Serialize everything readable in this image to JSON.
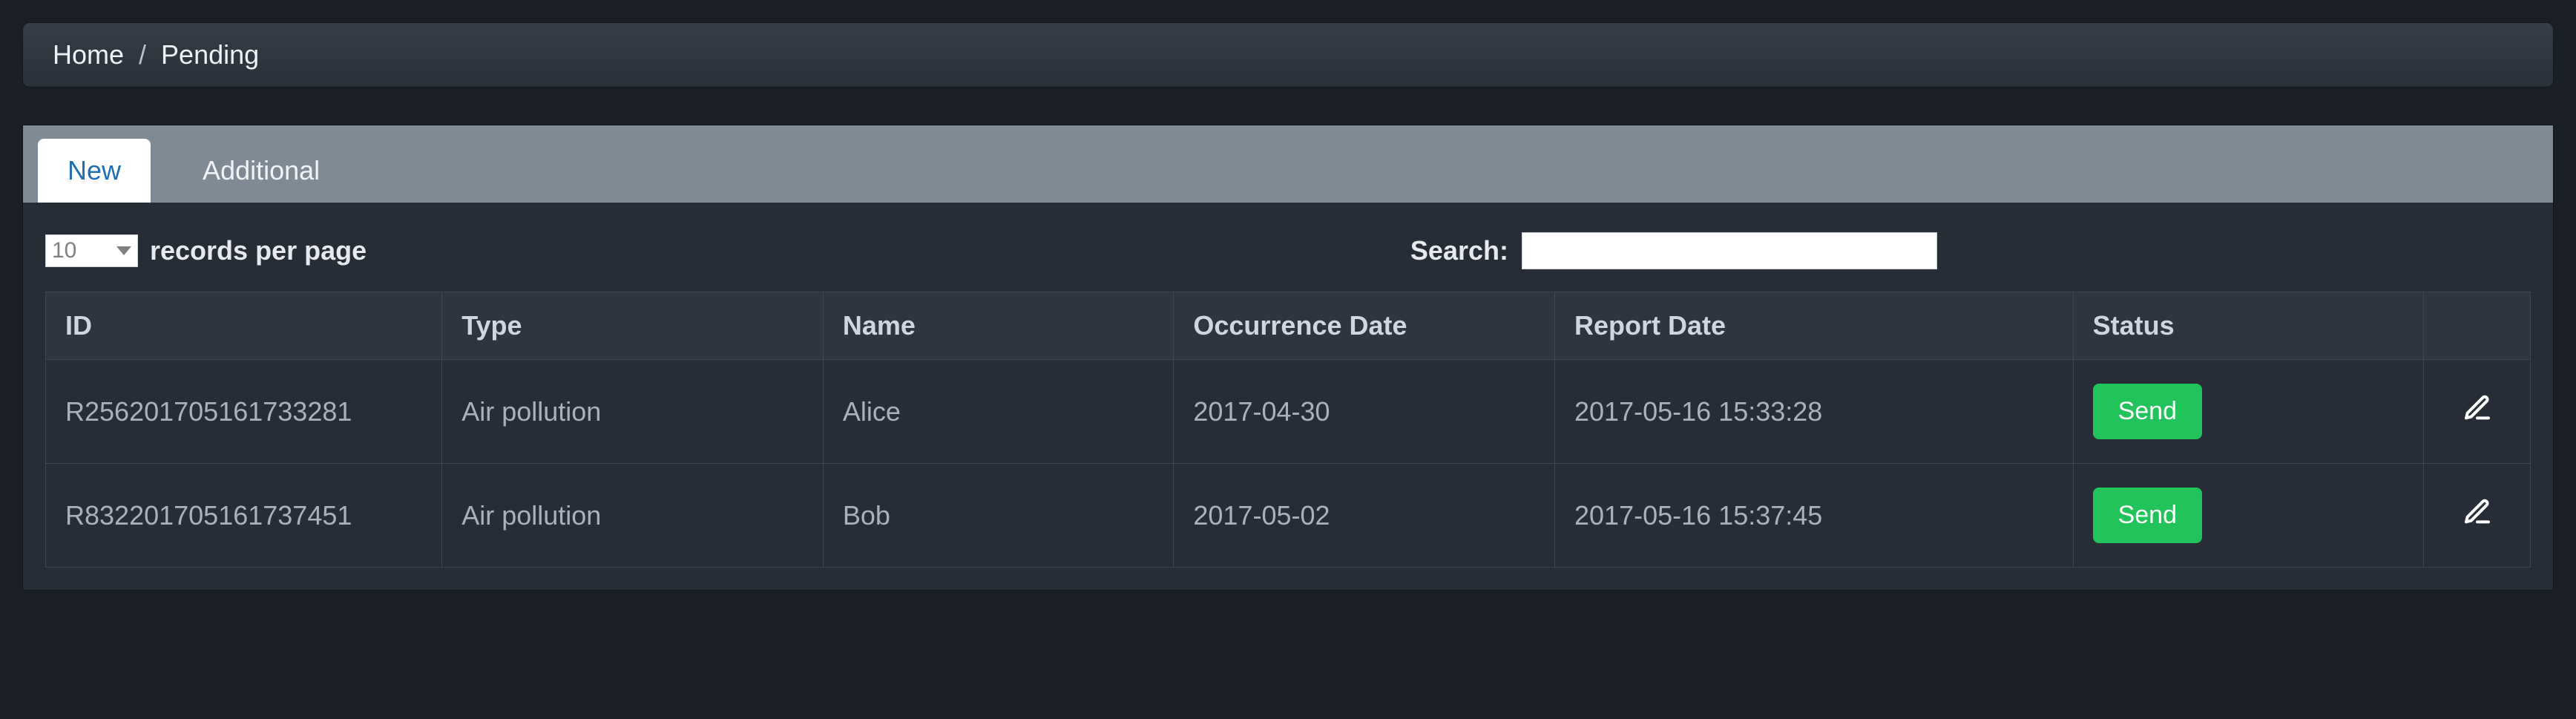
{
  "breadcrumb": {
    "home": "Home",
    "current": "Pending"
  },
  "tabs": {
    "new": "New",
    "additional": "Additional"
  },
  "controls": {
    "page_size": "10",
    "records_label": "records per page",
    "search_label": "Search:",
    "search_value": ""
  },
  "table": {
    "headers": {
      "id": "ID",
      "type": "Type",
      "name": "Name",
      "occ": "Occurrence Date",
      "rep": "Report Date",
      "status": "Status"
    },
    "send_label": "Send",
    "rows": [
      {
        "id": "R256201705161733281",
        "type": "Air pollution",
        "name": "Alice",
        "occ": "2017-04-30",
        "rep": "2017-05-16 15:33:28"
      },
      {
        "id": "R832201705161737451",
        "type": "Air pollution",
        "name": "Bob",
        "occ": "2017-05-02",
        "rep": "2017-05-16 15:37:45"
      }
    ]
  }
}
